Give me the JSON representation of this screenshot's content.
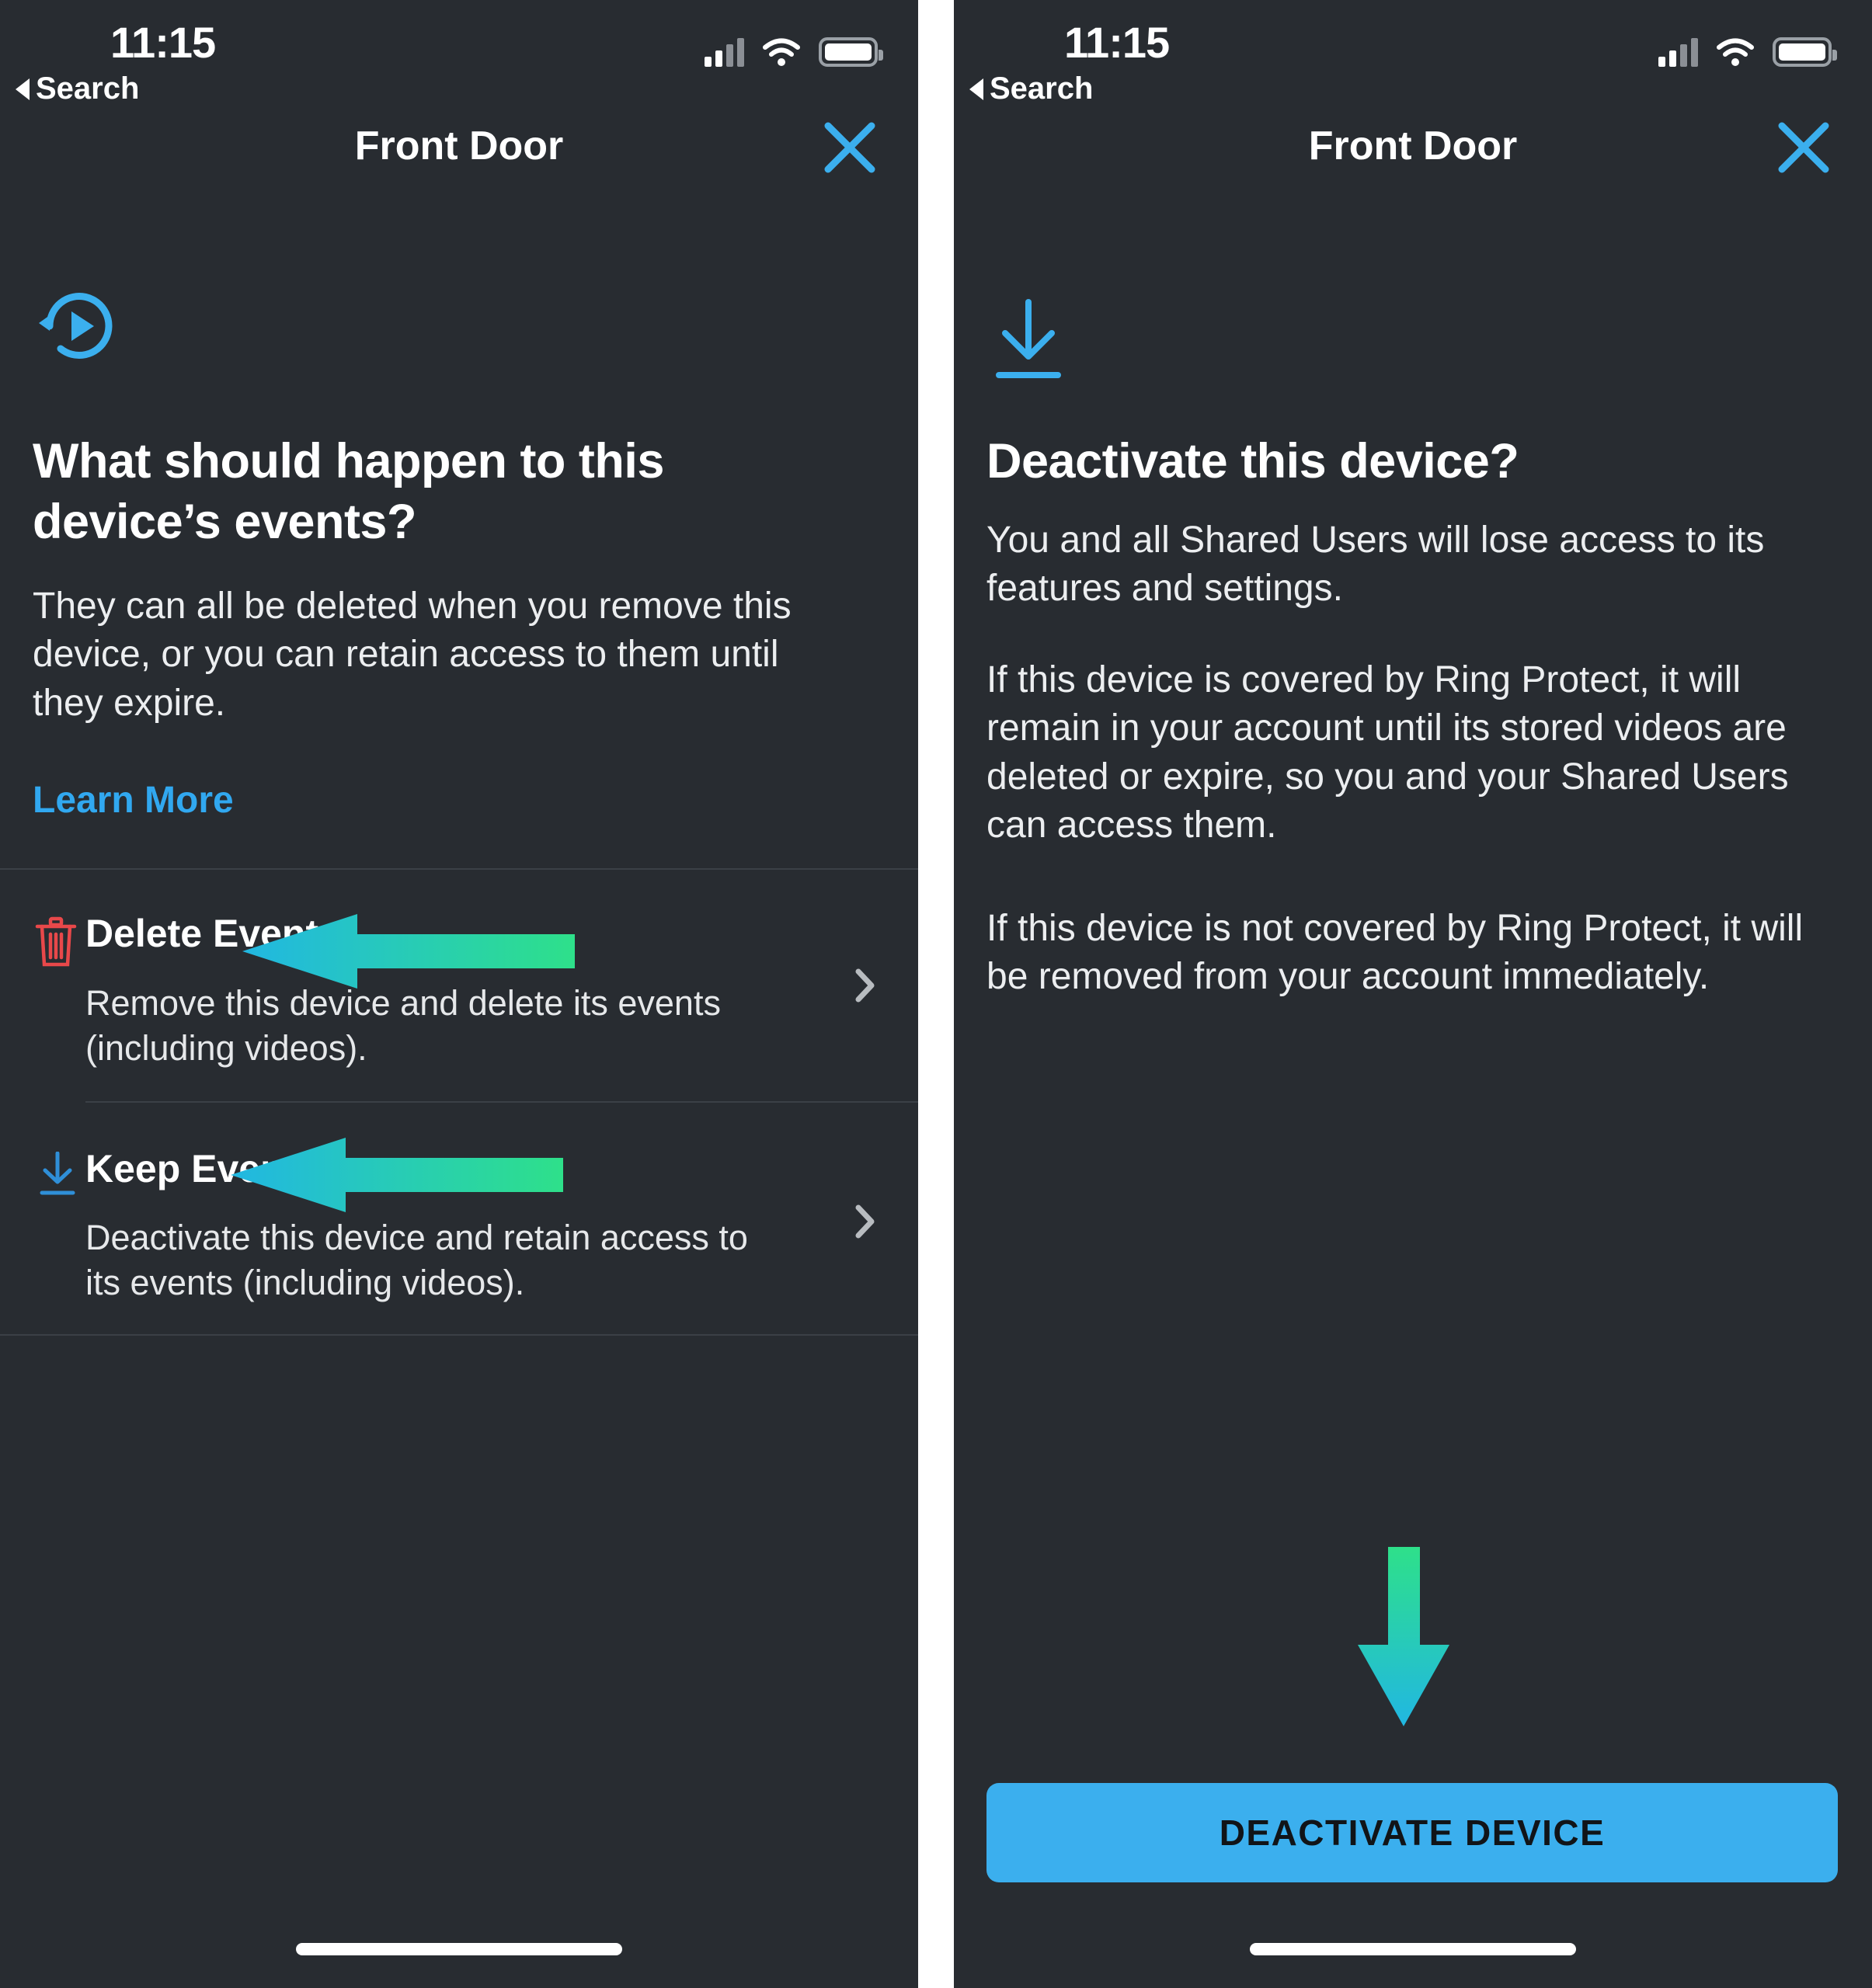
{
  "status_bar": {
    "time": "11:15",
    "back_label": "Search",
    "cellular_icon": "cellular-signal-icon",
    "wifi_icon": "wifi-icon",
    "battery_icon": "battery-icon"
  },
  "left_screen": {
    "header": {
      "title": "Front Door",
      "close_icon": "close-x-icon"
    },
    "hero_icon": "replay-play-circle-icon",
    "heading": "What should happen to this device’s events?",
    "body": "They can all be deleted when you remove this device, or you can retain access to them until they expire.",
    "learn_more": "Learn More",
    "options": [
      {
        "icon": "trash-icon",
        "title": "Delete Events",
        "subtitle": "Remove this device and delete its events (including videos).",
        "chevron": "chevron-right-icon"
      },
      {
        "icon": "download-save-icon",
        "title": "Keep Events",
        "subtitle": "Deactivate this device and retain access to its events (including videos).",
        "chevron": "chevron-right-icon"
      }
    ],
    "annotations": [
      {
        "name": "arrow-pointing-to-delete-events",
        "direction": "left"
      },
      {
        "name": "arrow-pointing-to-keep-events",
        "direction": "left"
      }
    ]
  },
  "right_screen": {
    "header": {
      "title": "Front Door",
      "close_icon": "close-x-icon"
    },
    "hero_icon": "download-save-icon",
    "heading": "Deactivate this device?",
    "paragraphs": [
      "You and all Shared Users will lose access to its features and settings.",
      "If this device is covered by Ring Protect, it will remain in your account until its stored videos are deleted or expire, so you and your Shared Users can access them.",
      "If this device is not covered by Ring Protect, it will be removed from your account immediately."
    ],
    "primary_button": "DEACTIVATE DEVICE",
    "annotations": [
      {
        "name": "arrow-pointing-to-deactivate-button",
        "direction": "down"
      }
    ]
  },
  "colors": {
    "background": "#282c31",
    "accent_blue": "#3bafee",
    "link_blue": "#31a8f0",
    "danger_red": "#e8484a",
    "text_primary": "#ffffff",
    "text_secondary": "#e6e8ea",
    "divider": "#3b4046",
    "annotation_gradient_start": "#2ee08a",
    "annotation_gradient_end": "#20b8e0",
    "button_text": "#111418"
  }
}
